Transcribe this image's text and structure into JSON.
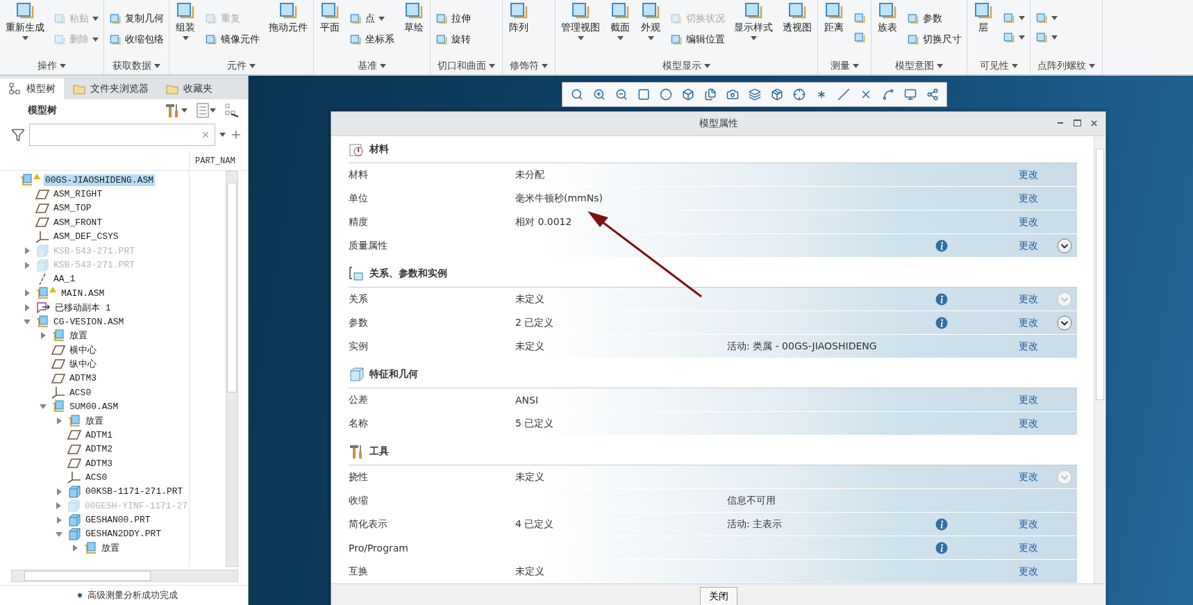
{
  "ribbon": {
    "groups": [
      {
        "label": "操作",
        "items": [
          {
            "kind": "large",
            "label": "重新生成",
            "menu": true,
            "disabled": false
          },
          {
            "kind": "small",
            "label": "粘贴",
            "menu": true,
            "disabled": true
          },
          {
            "kind": "small",
            "label": "删除",
            "menu": true,
            "disabled": true
          }
        ]
      },
      {
        "label": "获取数据",
        "items": [
          {
            "kind": "small",
            "label": "复制几何",
            "menu": false,
            "disabled": false
          },
          {
            "kind": "small",
            "label": "收缩包络",
            "menu": false,
            "disabled": false
          }
        ]
      },
      {
        "label": "元件",
        "items": [
          {
            "kind": "large",
            "label": "组装",
            "menu": true,
            "disabled": false
          },
          {
            "kind": "small",
            "label": "重复",
            "menu": false,
            "disabled": true
          },
          {
            "kind": "small",
            "label": "镜像元件",
            "menu": false,
            "disabled": false
          },
          {
            "kind": "large",
            "label": "拖动元件",
            "menu": false,
            "disabled": false
          }
        ]
      },
      {
        "label": "基准",
        "items": [
          {
            "kind": "large",
            "label": "平面",
            "menu": false,
            "disabled": false
          },
          {
            "kind": "small",
            "label": "点",
            "menu": true,
            "disabled": false
          },
          {
            "kind": "small",
            "label": "坐标系",
            "menu": false,
            "disabled": false
          },
          {
            "kind": "large",
            "label": "草绘",
            "menu": false,
            "disabled": false
          }
        ]
      },
      {
        "label": "切口和曲面",
        "items": [
          {
            "kind": "small",
            "label": "拉伸",
            "menu": false,
            "disabled": false
          },
          {
            "kind": "small",
            "label": "旋转",
            "menu": false,
            "disabled": false
          }
        ]
      },
      {
        "label": "修饰符",
        "items": [
          {
            "kind": "large",
            "label": "阵列",
            "menu": false,
            "disabled": false
          }
        ]
      },
      {
        "label": "模型显示",
        "items": [
          {
            "kind": "large",
            "label": "管理视图",
            "menu": true,
            "disabled": false
          },
          {
            "kind": "large",
            "label": "截面",
            "menu": true,
            "disabled": false
          },
          {
            "kind": "large",
            "label": "外观",
            "menu": true,
            "disabled": false
          },
          {
            "kind": "small",
            "label": "切换状况",
            "menu": false,
            "disabled": true
          },
          {
            "kind": "small",
            "label": "编辑位置",
            "menu": false,
            "disabled": false
          },
          {
            "kind": "large",
            "label": "显示样式",
            "menu": true,
            "disabled": false
          },
          {
            "kind": "large",
            "label": "透视图",
            "menu": false,
            "disabled": false
          }
        ]
      },
      {
        "label": "测量",
        "items": [
          {
            "kind": "large",
            "label": "距离",
            "menu": false,
            "disabled": false
          },
          {
            "kind": "icon",
            "menu": false,
            "disabled": false
          },
          {
            "kind": "icon",
            "menu": false,
            "disabled": false
          }
        ]
      },
      {
        "label": "模型意图",
        "items": [
          {
            "kind": "large",
            "label": "族表",
            "menu": false,
            "disabled": false
          },
          {
            "kind": "small",
            "label": "参数",
            "menu": false,
            "disabled": false
          },
          {
            "kind": "small",
            "label": "切换尺寸",
            "menu": false,
            "disabled": false
          }
        ]
      },
      {
        "label": "可见性",
        "items": [
          {
            "kind": "large",
            "label": "层",
            "menu": false,
            "disabled": false
          },
          {
            "kind": "icon",
            "menu": true,
            "disabled": false
          },
          {
            "kind": "icon",
            "menu": true,
            "disabled": false
          }
        ]
      },
      {
        "label": "点阵列螺纹",
        "items": [
          {
            "kind": "icon",
            "menu": true,
            "disabled": false
          },
          {
            "kind": "icon",
            "menu": true,
            "disabled": false
          }
        ]
      }
    ]
  },
  "model_tree": {
    "tabs": [
      {
        "label": "模型树",
        "selected": true
      },
      {
        "label": "文件夹浏览器",
        "selected": false
      },
      {
        "label": "收藏夹",
        "selected": false
      }
    ],
    "title": "模型树",
    "column_header": "PART_NAM",
    "items": [
      {
        "label": "00GS-JIAOSHIDENG.ASM",
        "kind": "assembly",
        "selected": true,
        "dimmed": false,
        "warning": true,
        "children": [
          {
            "label": "ASM_RIGHT",
            "kind": "plane",
            "selected": false,
            "dimmed": false,
            "warning": false
          },
          {
            "label": "ASM_TOP",
            "kind": "plane",
            "selected": false,
            "dimmed": false,
            "warning": false
          },
          {
            "label": "ASM_FRONT",
            "kind": "plane",
            "selected": false,
            "dimmed": false,
            "warning": false
          },
          {
            "label": "ASM_DEF_CSYS",
            "kind": "csys",
            "selected": false,
            "dimmed": false,
            "warning": false
          },
          {
            "label": "KSB-543-271.PRT",
            "kind": "part",
            "selected": false,
            "dimmed": true,
            "warning": false,
            "expanded": false
          },
          {
            "label": "KSB-543-271.PRT",
            "kind": "part",
            "selected": false,
            "dimmed": true,
            "warning": false,
            "expanded": false
          },
          {
            "label": "AA_1",
            "kind": "axis",
            "selected": false,
            "dimmed": false,
            "warning": false
          },
          {
            "label": "MAIN.ASM",
            "kind": "assembly",
            "selected": false,
            "dimmed": false,
            "warning": true,
            "expanded": false
          },
          {
            "label": "已移动副本 1",
            "kind": "copy",
            "selected": false,
            "dimmed": false,
            "warning": false,
            "expanded": false
          },
          {
            "label": "CG-VESION.ASM",
            "kind": "assembly",
            "selected": false,
            "dimmed": false,
            "warning": false,
            "expanded": true,
            "children": [
              {
                "label": "放置",
                "kind": "placement",
                "selected": false,
                "dimmed": false,
                "warning": false,
                "expanded": false
              },
              {
                "label": "横中心",
                "kind": "plane",
                "selected": false,
                "dimmed": false,
                "warning": false
              },
              {
                "label": "纵中心",
                "kind": "plane",
                "selected": false,
                "dimmed": false,
                "warning": false
              },
              {
                "label": "ADTM3",
                "kind": "plane",
                "selected": false,
                "dimmed": false,
                "warning": false
              },
              {
                "label": "ACS0",
                "kind": "csys",
                "selected": false,
                "dimmed": false,
                "warning": false
              },
              {
                "label": "SUM00.ASM",
                "kind": "assembly",
                "selected": false,
                "dimmed": false,
                "warning": false,
                "expanded": true,
                "children": [
                  {
                    "label": "放置",
                    "kind": "placement",
                    "selected": false,
                    "dimmed": false,
                    "warning": false,
                    "expanded": false
                  },
                  {
                    "label": "ADTM1",
                    "kind": "plane",
                    "selected": false,
                    "dimmed": false,
                    "warning": false
                  },
                  {
                    "label": "ADTM2",
                    "kind": "plane",
                    "selected": false,
                    "dimmed": false,
                    "warning": false
                  },
                  {
                    "label": "ADTM3",
                    "kind": "plane",
                    "selected": false,
                    "dimmed": false,
                    "warning": false
                  },
                  {
                    "label": "ACS0",
                    "kind": "csys",
                    "selected": false,
                    "dimmed": false,
                    "warning": false
                  },
                  {
                    "label": "00KSB-1171-271.PRT",
                    "kind": "part",
                    "selected": false,
                    "dimmed": false,
                    "warning": false,
                    "expanded": false
                  },
                  {
                    "label": "00GESH-YINF-1171-27",
                    "kind": "part",
                    "selected": false,
                    "dimmed": true,
                    "warning": false,
                    "expanded": false
                  },
                  {
                    "label": "GESHAN00.PRT",
                    "kind": "part",
                    "selected": false,
                    "dimmed": false,
                    "warning": false,
                    "expanded": false
                  },
                  {
                    "label": "GESHAN2DDY.PRT",
                    "kind": "part",
                    "selected": false,
                    "dimmed": false,
                    "warning": false,
                    "expanded": true,
                    "children": [
                      {
                        "label": "放置",
                        "kind": "placement",
                        "selected": false,
                        "dimmed": false,
                        "warning": false,
                        "expanded": false
                      }
                    ]
                  }
                ]
              }
            ]
          }
        ]
      }
    ]
  },
  "status_bar": {
    "message": "高级测量分析成功完成"
  },
  "dialog": {
    "title": "模型属性",
    "sections": [
      {
        "title": "材料",
        "kind": "material",
        "rows": [
          {
            "label": "材料",
            "value": "未分配",
            "info": false,
            "action": "更改"
          },
          {
            "label": "单位",
            "value": "毫米牛顿秒(mmNs)",
            "info": false,
            "action": "更改"
          },
          {
            "label": "精度",
            "value": "相对 0.0012",
            "info": false,
            "action": "更改"
          },
          {
            "label": "质量属性",
            "info": true,
            "action": "更改",
            "expander_enabled": true
          }
        ]
      },
      {
        "title": "关系、参数和实例",
        "kind": "relations",
        "rows": [
          {
            "label": "关系",
            "value": "未定义",
            "info": true,
            "action": "更改",
            "expander_enabled": false
          },
          {
            "label": "参数",
            "value": "2 已定义",
            "info": true,
            "action": "更改",
            "expander_enabled": true
          },
          {
            "label": "实例",
            "value": "未定义",
            "note": "活动: 类属 - 00GS-JIAOSHIDENG",
            "info": false,
            "action": "更改"
          }
        ]
      },
      {
        "title": "特征和几何",
        "kind": "features",
        "rows": [
          {
            "label": "公差",
            "value": "ANSI",
            "info": false,
            "action": "更改"
          },
          {
            "label": "名称",
            "value": "5 已定义",
            "info": false,
            "action": "更改"
          }
        ]
      },
      {
        "title": "工具",
        "kind": "tools",
        "rows": [
          {
            "label": "挠性",
            "value": "未定义",
            "info": false,
            "action": "更改",
            "expander_enabled": false
          },
          {
            "label": "收缩",
            "note": "信息不可用",
            "info": false
          },
          {
            "label": "简化表示",
            "value": "4 已定义",
            "note": "活动: 主表示",
            "info": true,
            "action": "更改"
          },
          {
            "label": "Pro/Program",
            "info": true,
            "action": "更改"
          },
          {
            "label": "互换",
            "value": "未定义",
            "info": false,
            "action": "更改"
          }
        ]
      }
    ],
    "close_button": "关闭"
  }
}
